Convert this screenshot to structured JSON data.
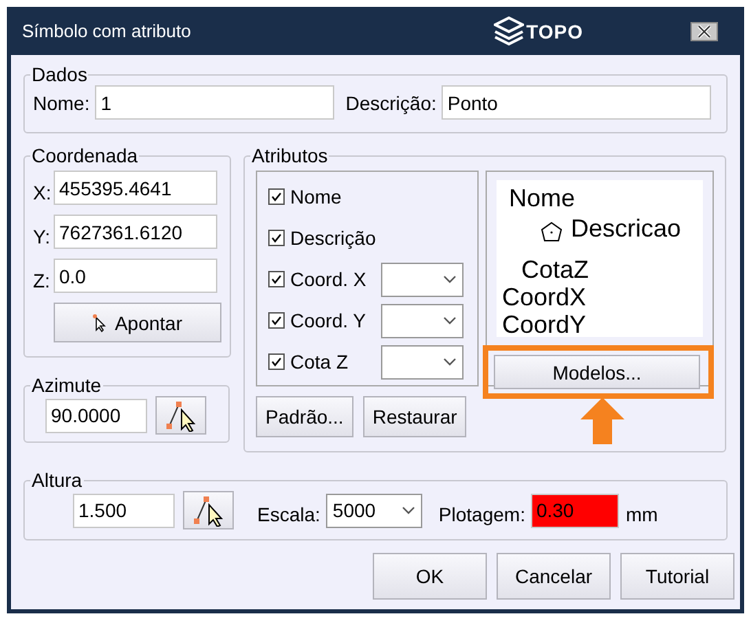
{
  "window": {
    "title": "Símbolo com atributo",
    "logo": "TOPO"
  },
  "dados": {
    "legend": "Dados",
    "fields": [
      {
        "label": "Nome:",
        "value": "1"
      },
      {
        "label": "Descrição:",
        "value": "Ponto"
      }
    ]
  },
  "coordenada": {
    "legend": "Coordenada",
    "fields": [
      {
        "label": "X:",
        "value": "455395.4641"
      },
      {
        "label": "Y:",
        "value": "7627361.6120"
      },
      {
        "label": "Z:",
        "value": "0.0"
      }
    ],
    "button": "Apontar"
  },
  "azimute": {
    "legend": "Azimute",
    "value": "90.0000"
  },
  "atributos": {
    "legend": "Atributos",
    "items": [
      {
        "label": "Nome",
        "checked": true,
        "kind": "plain"
      },
      {
        "label": "Descrição",
        "checked": true,
        "kind": "plain"
      },
      {
        "label": "Coord. X",
        "checked": true,
        "kind": "dropdown"
      },
      {
        "label": "Coord. Y",
        "checked": true,
        "kind": "dropdown"
      },
      {
        "label": "Cota Z",
        "checked": true,
        "kind": "dropdown"
      }
    ],
    "preview": [
      {
        "text": "Nome",
        "kind": "text"
      },
      {
        "text": "Descricao",
        "kind": "point"
      },
      {
        "text": "CotaZ",
        "kind": "text"
      },
      {
        "text": "CoordX",
        "kind": "text"
      },
      {
        "text": "CoordY",
        "kind": "text"
      }
    ],
    "models_button": "Modelos...",
    "highlighted": true,
    "buttons": [
      "Padrão...",
      "Restaurar"
    ]
  },
  "altura": {
    "legend": "Altura",
    "value": "1.500",
    "escala_label": "Escala:",
    "escala": "5000",
    "plotagem_label": "Plotagem:",
    "plotagem": "0.30",
    "plotagem_invalid": true,
    "unit": "mm"
  },
  "buttons": [
    "OK",
    "Cancelar",
    "Tutorial"
  ]
}
